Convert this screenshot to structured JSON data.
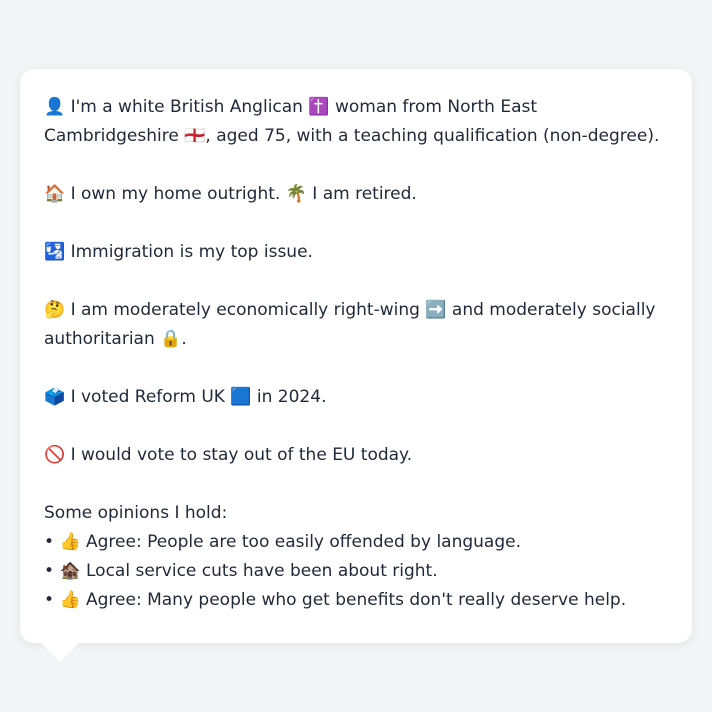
{
  "card": {
    "identity": {
      "icon": "👤",
      "text_1": " I'm a white British Anglican ",
      "icon_religion": "✝️",
      "text_2": " woman from North East Cambridgeshire ",
      "icon_flag": "🏴󠁧󠁢󠁥󠁮󠁧󠁿",
      "text_3": ", aged 75, with a teaching qualification (non-degree)."
    },
    "housing": {
      "icon": "🏠",
      "text_1": " I own my home outright. ",
      "icon_retired": "🌴",
      "text_2": " I am retired."
    },
    "issue": {
      "icon": "🛂",
      "text": " Immigration is my top issue."
    },
    "ideology": {
      "icon": "🤔",
      "text_1": " I am moderately economically right-wing ",
      "icon_right": "➡️",
      "text_2": " and moderately socially authoritarian ",
      "icon_lock": "🔒",
      "text_3": "."
    },
    "vote": {
      "icon": "🗳️",
      "text_1": " I voted Reform UK ",
      "icon_party": "🟦",
      "text_2": " in 2024."
    },
    "eu": {
      "icon": "🚫",
      "text": " I would vote to stay out of the EU today."
    },
    "opinions": {
      "heading": "Some opinions I hold:",
      "items": [
        {
          "bullet": "• ",
          "icon": "👍",
          "text": " Agree: People are too easily offended by language."
        },
        {
          "bullet": "• ",
          "icon": "🏚️",
          "text": " Local service cuts have been about right."
        },
        {
          "bullet": "• ",
          "icon": "👍",
          "text": " Agree: Many people who get benefits don't really deserve help."
        }
      ]
    }
  }
}
